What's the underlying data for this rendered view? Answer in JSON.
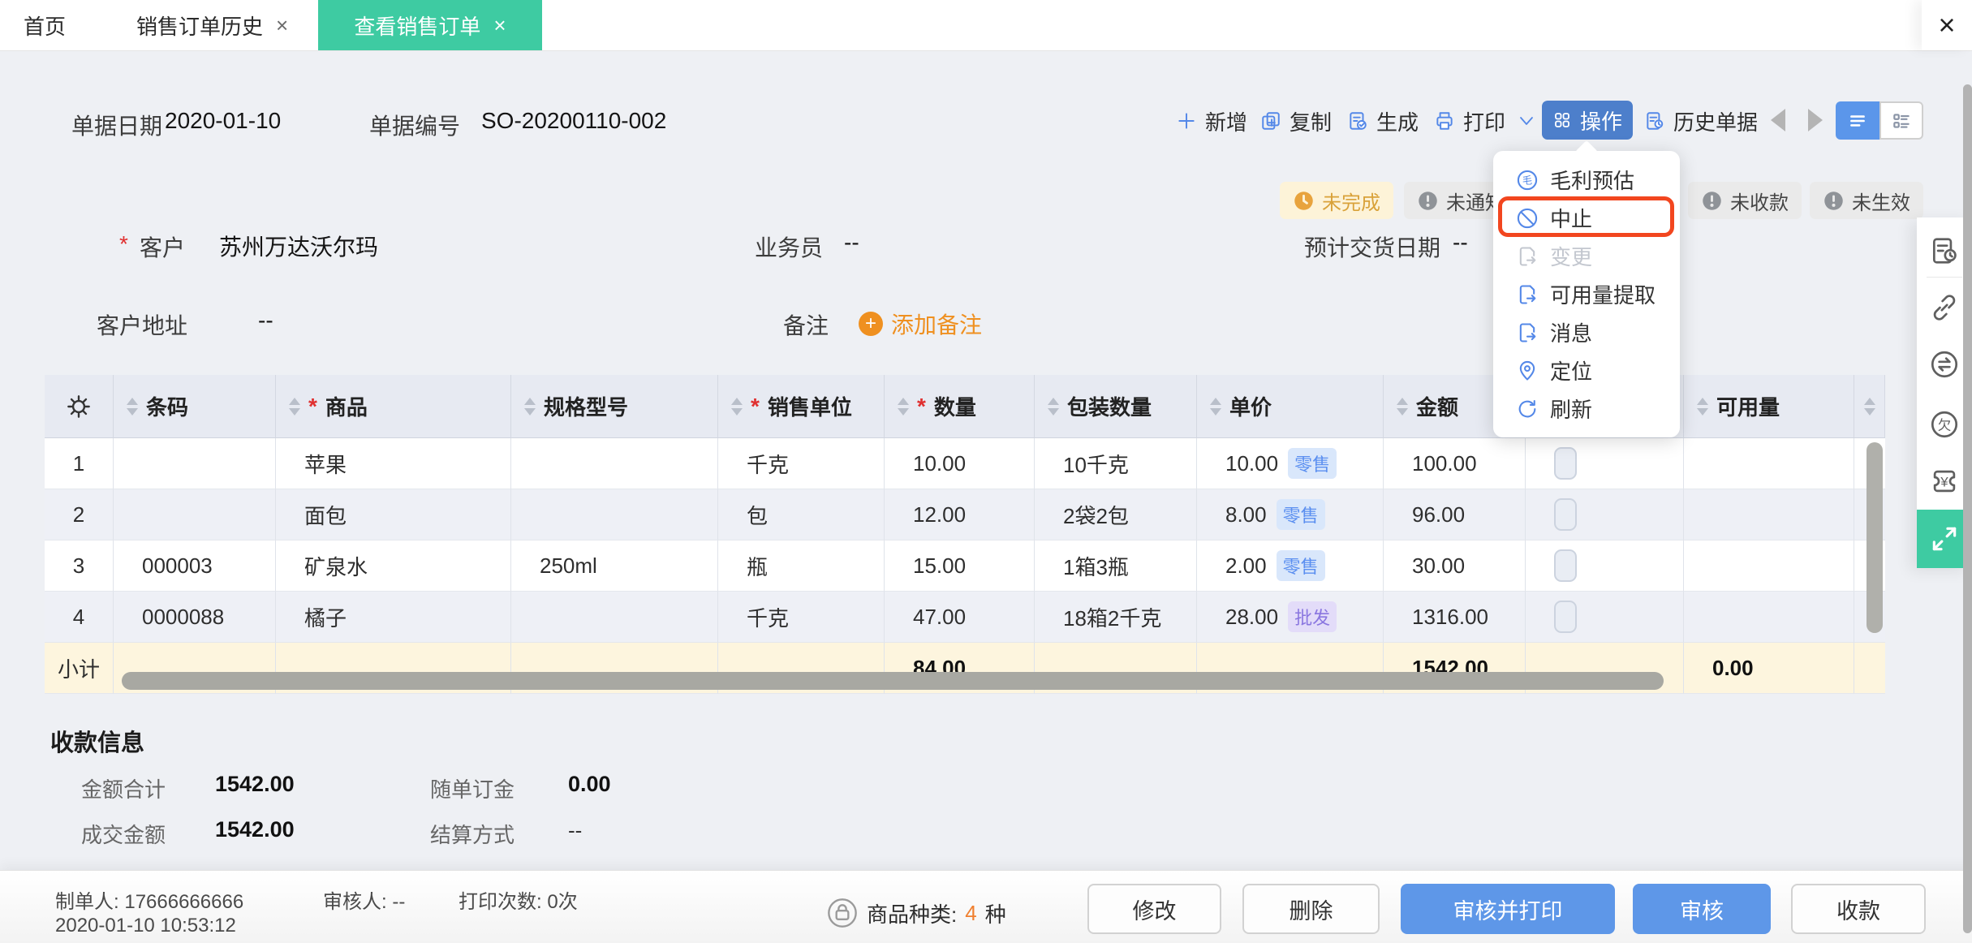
{
  "tab_bar": {
    "tabs": [
      {
        "label": "首页"
      },
      {
        "label": "销售订单历史"
      },
      {
        "label": "查看销售订单"
      }
    ]
  },
  "doc_header": {
    "date_label": "单据日期",
    "date_value": "2020-01-10",
    "number_label": "单据编号",
    "number_value": "SO-20200110-002"
  },
  "toolbar": {
    "add": "新增",
    "copy": "复制",
    "generate": "生成",
    "print": "打印",
    "action": "操作",
    "history": "历史单据"
  },
  "badges": {
    "incomplete": "未完成",
    "unnotified": "未通知",
    "unpaid": "未收款",
    "ineffective": "未生效"
  },
  "action_menu": {
    "items": [
      {
        "label": "毛利预估"
      },
      {
        "label": "中止"
      },
      {
        "label": "变更"
      },
      {
        "label": "可用量提取"
      },
      {
        "label": "消息"
      },
      {
        "label": "定位"
      },
      {
        "label": "刷新"
      }
    ]
  },
  "form": {
    "customer_label": "客户",
    "customer_value": "苏州万达沃尔玛",
    "salesman_label": "业务员",
    "salesman_value": "--",
    "delivery_label": "预计交货日期",
    "delivery_value": "--",
    "address_label": "客户地址",
    "address_value": "--",
    "remark_label": "备注",
    "add_remark_label": "添加备注"
  },
  "table": {
    "columns": [
      {
        "label": "条码"
      },
      {
        "label": "商品"
      },
      {
        "label": "规格型号"
      },
      {
        "label": "销售单位"
      },
      {
        "label": "数量"
      },
      {
        "label": "包装数量"
      },
      {
        "label": "单价"
      },
      {
        "label": "金额"
      },
      {
        "label": "可用量"
      }
    ],
    "rows": [
      {
        "no": "1",
        "barcode": "",
        "product": "苹果",
        "spec": "",
        "unit": "千克",
        "qty": "10.00",
        "pack": "10千克",
        "price": "10.00",
        "price_tag": "零售",
        "amount": "100.00",
        "avail": ""
      },
      {
        "no": "2",
        "barcode": "",
        "product": "面包",
        "spec": "",
        "unit": "包",
        "qty": "12.00",
        "pack": "2袋2包",
        "price": "8.00",
        "price_tag": "零售",
        "amount": "96.00",
        "avail": ""
      },
      {
        "no": "3",
        "barcode": "000003",
        "product": "矿泉水",
        "spec": "250ml",
        "unit": "瓶",
        "qty": "15.00",
        "pack": "1箱3瓶",
        "price": "2.00",
        "price_tag": "零售",
        "amount": "30.00",
        "avail": ""
      },
      {
        "no": "4",
        "barcode": "0000088",
        "product": "橘子",
        "spec": "",
        "unit": "千克",
        "qty": "47.00",
        "pack": "18箱2千克",
        "price": "28.00",
        "price_tag": "批发",
        "amount": "1316.00",
        "avail": ""
      }
    ],
    "subtotal": {
      "label": "小计",
      "qty": "84.00",
      "amount": "1542.00",
      "avail": "0.00"
    }
  },
  "payment": {
    "title": "收款信息",
    "total_label": "金额合计",
    "total_value": "1542.00",
    "deposit_label": "随单订金",
    "deposit_value": "0.00",
    "deal_label": "成交金额",
    "deal_value": "1542.00",
    "settle_label": "结算方式",
    "settle_value": "--"
  },
  "footer": {
    "creator_label": "制单人:",
    "creator_value": "17666666666",
    "created_time": "2020-01-10 10:53:12",
    "auditor_label": "审核人:",
    "auditor_value": "--",
    "print_label": "打印次数:",
    "print_value": "0次",
    "category_label": "商品种类:",
    "category_count": "4",
    "category_unit": "种",
    "buttons": {
      "modify": "修改",
      "delete": "删除",
      "audit_print": "审核并打印",
      "audit": "审核",
      "receive": "收款"
    }
  },
  "colors": {
    "accent_green": "#3ecba2",
    "primary_blue": "#5488e8",
    "action_button_blue": "#4d7fcb",
    "warning_text": "#d9a23a",
    "warning_bg": "#fdf3d8",
    "highlight_red": "#f2461f",
    "retail_tag": "#5b8ff0",
    "wholesale_tag": "#8a76e0",
    "orange_accent": "#ef9020",
    "subtotal_bg": "#fdf5de"
  }
}
